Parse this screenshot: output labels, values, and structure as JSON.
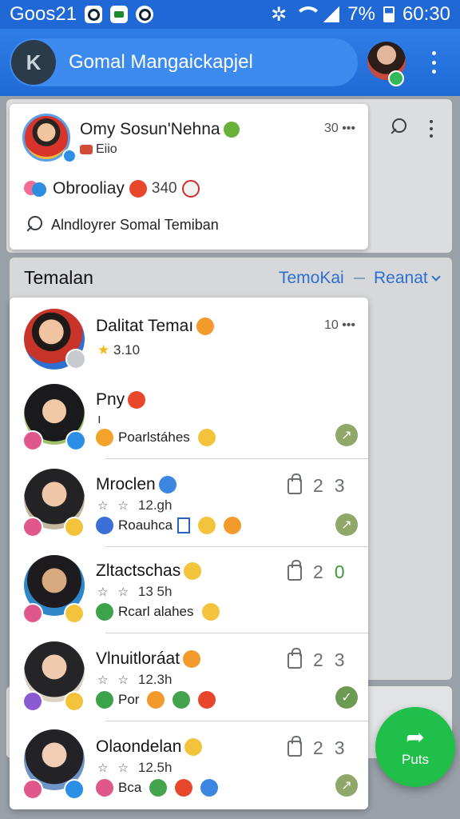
{
  "status_bar": {
    "time_left": "Goos21",
    "battery": "7%",
    "time_right": "60:30"
  },
  "app_bar": {
    "title": "Gomal Mangaickapjel"
  },
  "post": {
    "author": "Omy Sosun'Nehna",
    "subtitle": "Eiio",
    "time": "30",
    "reaction_text": "Obrooliay",
    "reaction_count": "340",
    "search_text": "Alndloyrer Somal Temiban"
  },
  "friends_section": {
    "title": "Temalan",
    "tab_a": "TemoKai",
    "tab_b": "Reanat"
  },
  "friends": [
    {
      "name": "Dalitat Temaı",
      "rating": "3.10",
      "time": "10"
    },
    {
      "name": "Pny",
      "meta": "ı",
      "status": "Poarlstáhes"
    },
    {
      "name": "Mroclen",
      "meta": "12.gh",
      "status": "Roauhca",
      "count_a": "2",
      "count_b": "3"
    },
    {
      "name": "Zltactschas",
      "meta": "13 5h",
      "status": "Rcarl alahes",
      "count_a": "2",
      "count_b": "0"
    },
    {
      "name": "Vlnuitloráat",
      "meta": "12.3h",
      "status": "Por",
      "count_a": "2",
      "count_b": "3"
    },
    {
      "name": "Olaondelan",
      "meta": "12.5h",
      "status": "Bca",
      "count_a": "2",
      "count_b": "3"
    }
  ],
  "fab": {
    "label": "Puts"
  },
  "colors": {
    "primary": "#1f68d6",
    "fab": "#1fbf4a",
    "link": "#2c6fd0"
  },
  "icons": [
    "bluetooth-icon",
    "wifi-icon",
    "signal-icon",
    "battery-icon",
    "search-icon",
    "more-vert-icon",
    "lock-icon",
    "share-icon"
  ]
}
